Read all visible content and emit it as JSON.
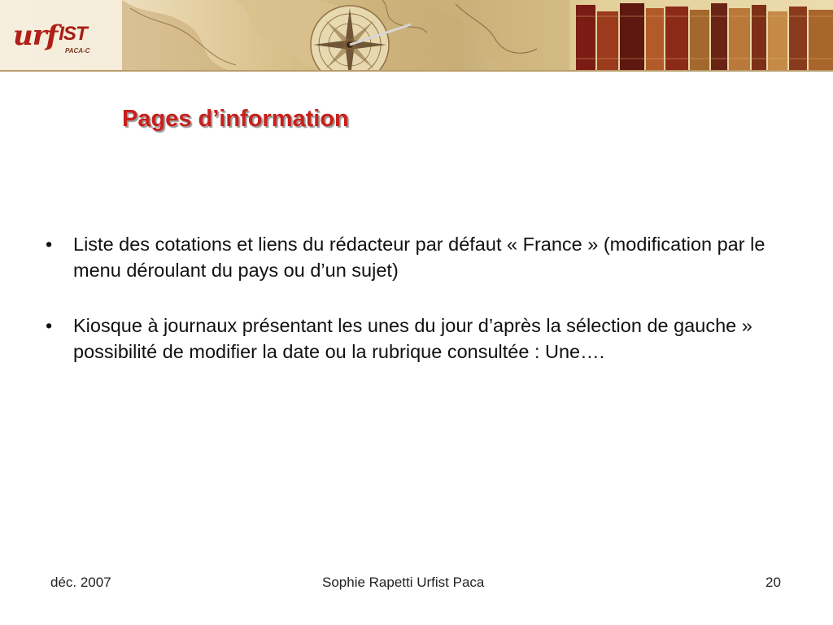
{
  "logo": {
    "main": "urf",
    "accent": "IST",
    "subtitle": "PACA-C"
  },
  "slide": {
    "title": "Pages d’information",
    "bullet_symbol": "•",
    "bullets": [
      "Liste des cotations et  liens du rédacteur par défaut « France » (modification par le menu déroulant du pays ou d’un sujet)",
      "Kiosque à journaux présentant les unes du jour d’après la sélection de gauche » possibilité de modifier la date ou la rubrique consultée : Une…."
    ]
  },
  "footer": {
    "date": "déc. 2007",
    "author": "Sophie Rapetti Urfist Paca",
    "page_number": "20"
  },
  "colors": {
    "title": "#c8201c",
    "logo": "#b01f1a",
    "text": "#111111"
  }
}
